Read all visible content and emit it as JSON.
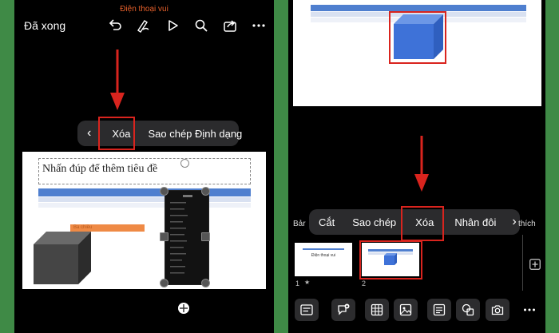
{
  "left": {
    "watermark": "Điện thoại vui",
    "done_label": "Đã xong",
    "toolbar_icons": [
      "undo-icon",
      "pen-icon",
      "play-icon",
      "search-icon",
      "share-icon",
      "more-icon"
    ],
    "context_menu": {
      "back": "‹",
      "items": [
        "Xóa",
        "Sao chép Định dạng"
      ]
    },
    "slide": {
      "title_placeholder": "Nhấn đúp để thêm tiêu đề",
      "orange_label": "Ba chiều"
    }
  },
  "right": {
    "context_menu": {
      "left_partial": "Bảr",
      "items": [
        "Cắt",
        "Sao chép",
        "Xóa",
        "Nhân đôi"
      ],
      "next": "›",
      "right_partial": "thích"
    },
    "thumbnails": [
      {
        "number": "1",
        "star": "★",
        "title": "Điện thoại vui"
      },
      {
        "number": "2"
      }
    ],
    "add_slide_icon": "plus-icon",
    "bottom_icons": [
      "layout-icon",
      "comment-add-icon",
      "table-icon",
      "image-icon",
      "text-icon",
      "shapes-icon",
      "camera-icon",
      "more-icon"
    ]
  },
  "colors": {
    "highlight": "#d9241e",
    "watermark": "#e6602b",
    "accent_blue": "#4f7fcf"
  }
}
